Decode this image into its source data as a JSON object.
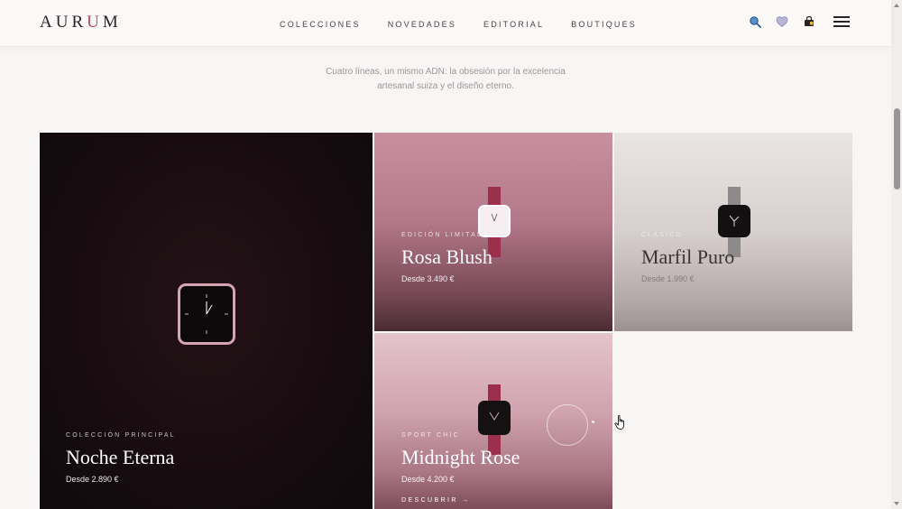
{
  "header": {
    "logo": {
      "part1": "AUR",
      "accent": "U",
      "part2": "M"
    },
    "nav": [
      "Colecciones",
      "Novedades",
      "Editorial",
      "Boutiques"
    ],
    "icons": [
      "search-icon",
      "heart-icon",
      "bag-icon",
      "menu-icon"
    ]
  },
  "intro": {
    "line1": "Cuatro líneas, un mismo ADN: la obsesión por la excelencia",
    "line2": "artesanal suiza y el diseño eterno."
  },
  "cards": {
    "noche": {
      "label": "Colección Principal",
      "title": "Noche Eterna",
      "price": "Desde 2.890 €"
    },
    "rosa": {
      "label": "Edición Limitada",
      "title": "Rosa Blush",
      "price": "Desde 3.490 €"
    },
    "marfil": {
      "label": "Clásico",
      "title": "Marfil Puro",
      "price": "Desde 1.990 €"
    },
    "midnight": {
      "label": "Sport Chic",
      "title": "Midnight Rose",
      "price": "Desde 4.200 €",
      "cta": "Descubrir →"
    }
  },
  "colors": {
    "accent": "#b24a61",
    "text_dark": "#2a2326",
    "background": "#f8f6f5"
  }
}
